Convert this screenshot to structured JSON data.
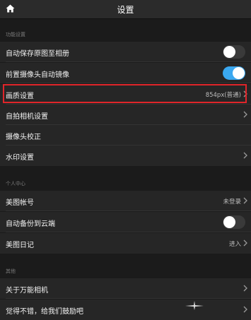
{
  "header": {
    "title": "设置",
    "home_icon": "home-icon"
  },
  "sections": {
    "functions": {
      "label": "功能设置",
      "items": [
        {
          "label": "自动保存原图至相册",
          "toggle": "off"
        },
        {
          "label": "前置摄像头自动镜像",
          "toggle": "on"
        },
        {
          "label": "画质设置",
          "value": "854px(普通)",
          "chevron": true,
          "highlighted": true
        },
        {
          "label": "自拍相机设置",
          "chevron": true
        },
        {
          "label": "摄像头校正"
        },
        {
          "label": "水印设置",
          "chevron": true
        }
      ]
    },
    "personal": {
      "label": "个人中心",
      "items": [
        {
          "label": "美图帐号",
          "value": "未登录",
          "chevron": true
        },
        {
          "label": "自动备份到云端",
          "toggle": "off"
        },
        {
          "label": "美图日记",
          "value": "进入",
          "chevron": true
        }
      ]
    },
    "other": {
      "label": "其他",
      "items": [
        {
          "label": "关于万能相机",
          "chevron": true
        },
        {
          "label": "觉得不错，给我们鼓励吧",
          "chevron": false
        }
      ]
    }
  },
  "colors": {
    "background": "#1b1b1b",
    "row": "#262626",
    "toggle_on": "#3aa8f0",
    "highlight": "#e0252a"
  }
}
